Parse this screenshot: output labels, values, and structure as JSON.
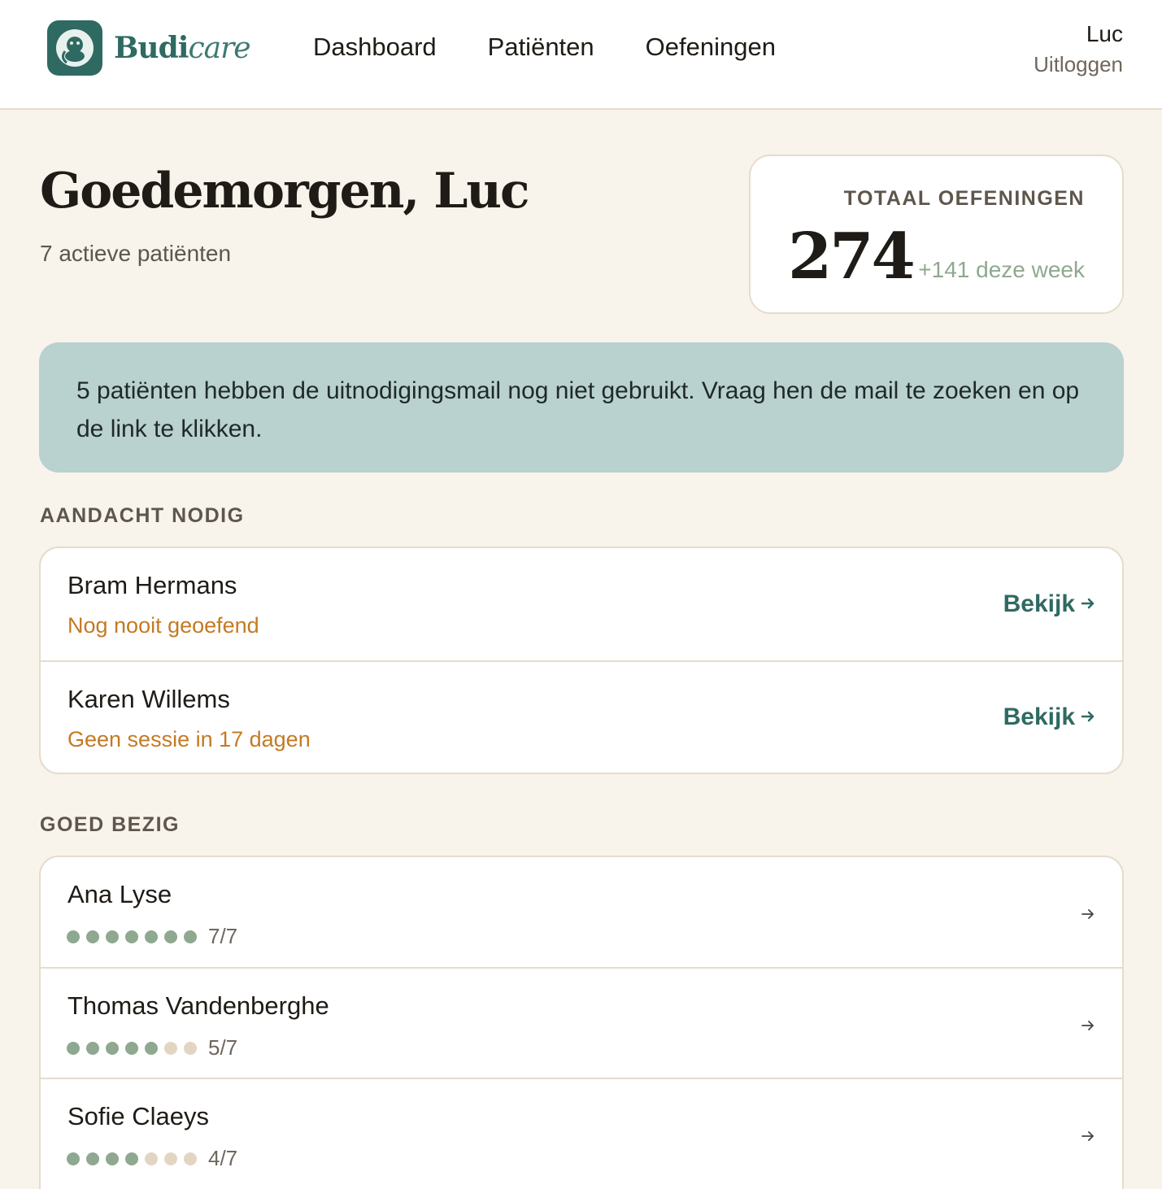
{
  "header": {
    "brand_main": "Budi",
    "brand_accent": "care",
    "nav": [
      "Dashboard",
      "Patiënten",
      "Oefeningen"
    ],
    "user_name": "Luc",
    "logout_label": "Uitloggen"
  },
  "greeting": {
    "title": "Goedemorgen, Luc",
    "subtitle": "7 actieve patiënten"
  },
  "stat": {
    "label": "TOTAAL OEFENINGEN",
    "value": "274",
    "delta": "+141 deze week"
  },
  "banner": {
    "text": "5 patiënten hebben de uitnodigingsmail nog niet gebruikt. Vraag hen de mail te zoeken en op de link te klikken."
  },
  "attention": {
    "title": "AANDACHT NODIG",
    "action_label": "Bekijk",
    "patients": [
      {
        "name": "Bram Hermans",
        "status": "Nog nooit geoefend"
      },
      {
        "name": "Karen Willems",
        "status": "Geen sessie in 17 dagen"
      }
    ]
  },
  "good": {
    "title": "GOED BEZIG",
    "patients": [
      {
        "name": "Ana Lyse",
        "done": 7,
        "total": 7,
        "label": "7/7"
      },
      {
        "name": "Thomas Vandenberghe",
        "done": 5,
        "total": 7,
        "label": "5/7"
      },
      {
        "name": "Sofie Claeys",
        "done": 4,
        "total": 7,
        "label": "4/7"
      }
    ]
  },
  "colors": {
    "brand": "#2f6a62",
    "warning": "#c47a23",
    "progress_on": "#8fa890",
    "progress_off": "#e2d6c3",
    "banner": "#b9d1cf",
    "page_bg": "#f8f3eb"
  }
}
